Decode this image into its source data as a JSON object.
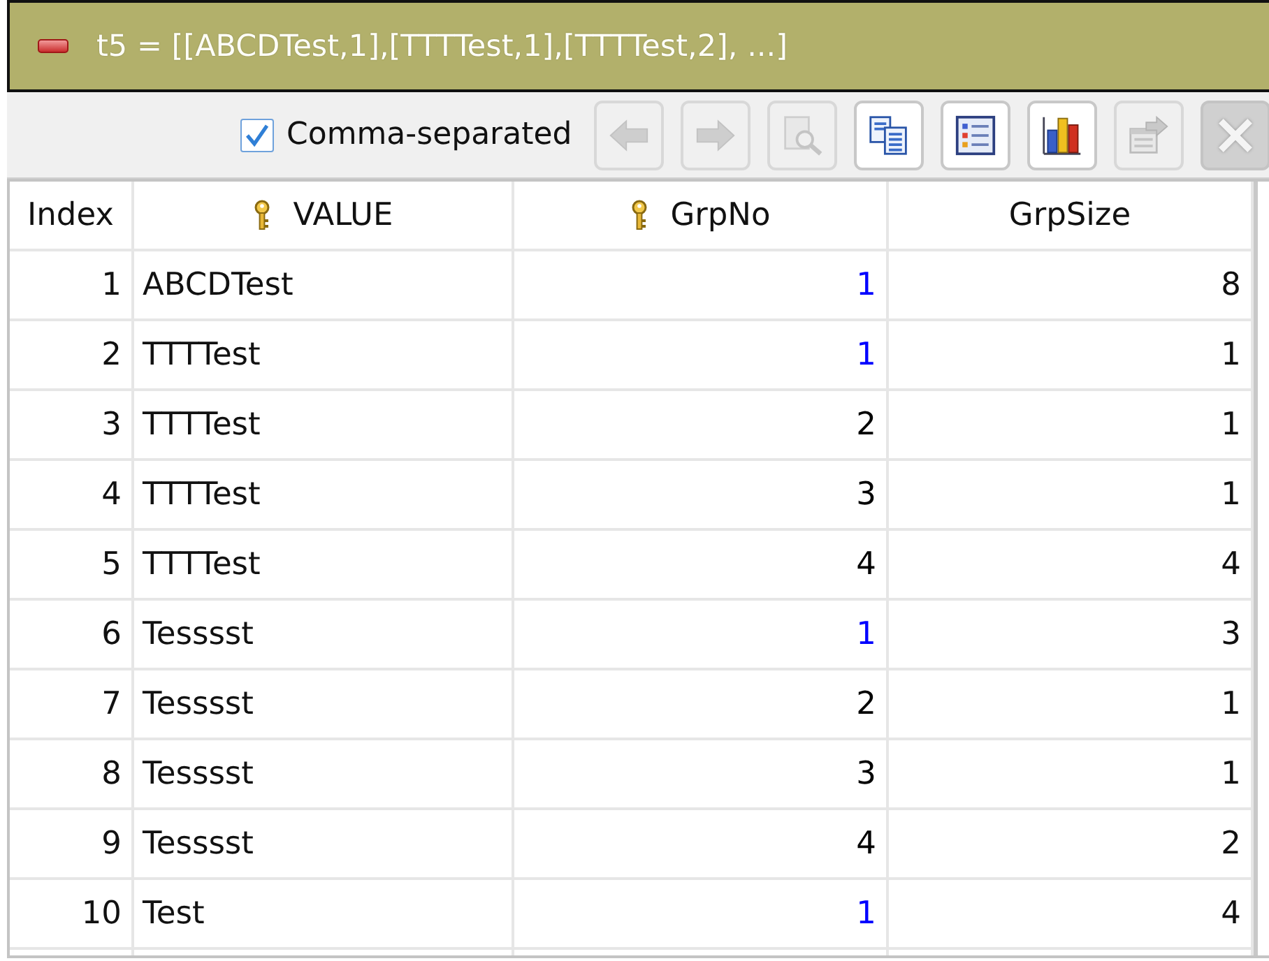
{
  "header": {
    "title": "t5 = [[ABCDTest,1],[TTTTest,1],[TTTTest,2], ...]"
  },
  "toolbar": {
    "checkbox": {
      "label": "Comma-separated",
      "checked": true
    },
    "buttons": [
      {
        "kind": "back",
        "disabled": true
      },
      {
        "kind": "forward",
        "disabled": true
      },
      {
        "kind": "preview",
        "disabled": true
      },
      {
        "kind": "copy",
        "disabled": false
      },
      {
        "kind": "list",
        "disabled": false
      },
      {
        "kind": "chart",
        "disabled": false
      },
      {
        "kind": "properties",
        "disabled": true
      },
      {
        "kind": "close",
        "disabled": true
      }
    ]
  },
  "table": {
    "columns": [
      {
        "label": "Index",
        "key": false
      },
      {
        "label": "VALUE",
        "key": true
      },
      {
        "label": "GrpNo",
        "key": true
      },
      {
        "label": "GrpSize",
        "key": false
      }
    ],
    "rows": [
      {
        "index": "1",
        "value": "ABCDTest",
        "grpno": {
          "text": "1",
          "color": "#0000ff"
        },
        "grpsize": "8"
      },
      {
        "index": "2",
        "value": "TTTTest",
        "grpno": {
          "text": "1",
          "color": "#0000ff"
        },
        "grpsize": "1"
      },
      {
        "index": "3",
        "value": "TTTTest",
        "grpno": {
          "text": "2",
          "color": "#000000"
        },
        "grpsize": "1"
      },
      {
        "index": "4",
        "value": "TTTTest",
        "grpno": {
          "text": "3",
          "color": "#000000"
        },
        "grpsize": "1"
      },
      {
        "index": "5",
        "value": "TTTTest",
        "grpno": {
          "text": "4",
          "color": "#000000"
        },
        "grpsize": "4"
      },
      {
        "index": "6",
        "value": "Tesssst",
        "grpno": {
          "text": "1",
          "color": "#0000ff"
        },
        "grpsize": "3"
      },
      {
        "index": "7",
        "value": "Tesssst",
        "grpno": {
          "text": "2",
          "color": "#000000"
        },
        "grpsize": "1"
      },
      {
        "index": "8",
        "value": "Tesssst",
        "grpno": {
          "text": "3",
          "color": "#000000"
        },
        "grpsize": "1"
      },
      {
        "index": "9",
        "value": "Tesssst",
        "grpno": {
          "text": "4",
          "color": "#000000"
        },
        "grpsize": "2"
      },
      {
        "index": "10",
        "value": "Test",
        "grpno": {
          "text": "1",
          "color": "#0000ff"
        },
        "grpsize": "4"
      }
    ]
  }
}
